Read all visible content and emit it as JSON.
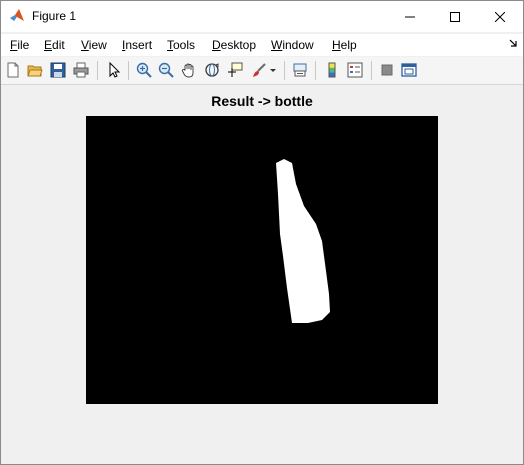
{
  "window": {
    "title": "Figure 1"
  },
  "menu": {
    "items": [
      {
        "prefix": "",
        "accel": "F",
        "rest": "ile"
      },
      {
        "prefix": "",
        "accel": "E",
        "rest": "dit"
      },
      {
        "prefix": "",
        "accel": "V",
        "rest": "iew"
      },
      {
        "prefix": "",
        "accel": "I",
        "rest": "nsert"
      },
      {
        "prefix": "",
        "accel": "T",
        "rest": "ools"
      },
      {
        "prefix": "",
        "accel": "D",
        "rest": "esktop"
      },
      {
        "prefix": "",
        "accel": "W",
        "rest": "indow"
      },
      {
        "prefix": "",
        "accel": "H",
        "rest": "elp"
      }
    ]
  },
  "toolbar": {
    "buttons": [
      "new-figure",
      "open-file",
      "save",
      "print",
      "edit-plot",
      "zoom-in",
      "zoom-out",
      "pan",
      "rotate-3d",
      "data-cursor",
      "brush",
      "link-plot",
      "colorbar",
      "legend",
      "hide-plot-tools",
      "show-plot-tools"
    ]
  },
  "figure": {
    "axes_title": "Result -> bottle",
    "image": {
      "background": "#000000",
      "foreground": "#ffffff",
      "content": "binary segmentation mask of a bottle"
    }
  }
}
